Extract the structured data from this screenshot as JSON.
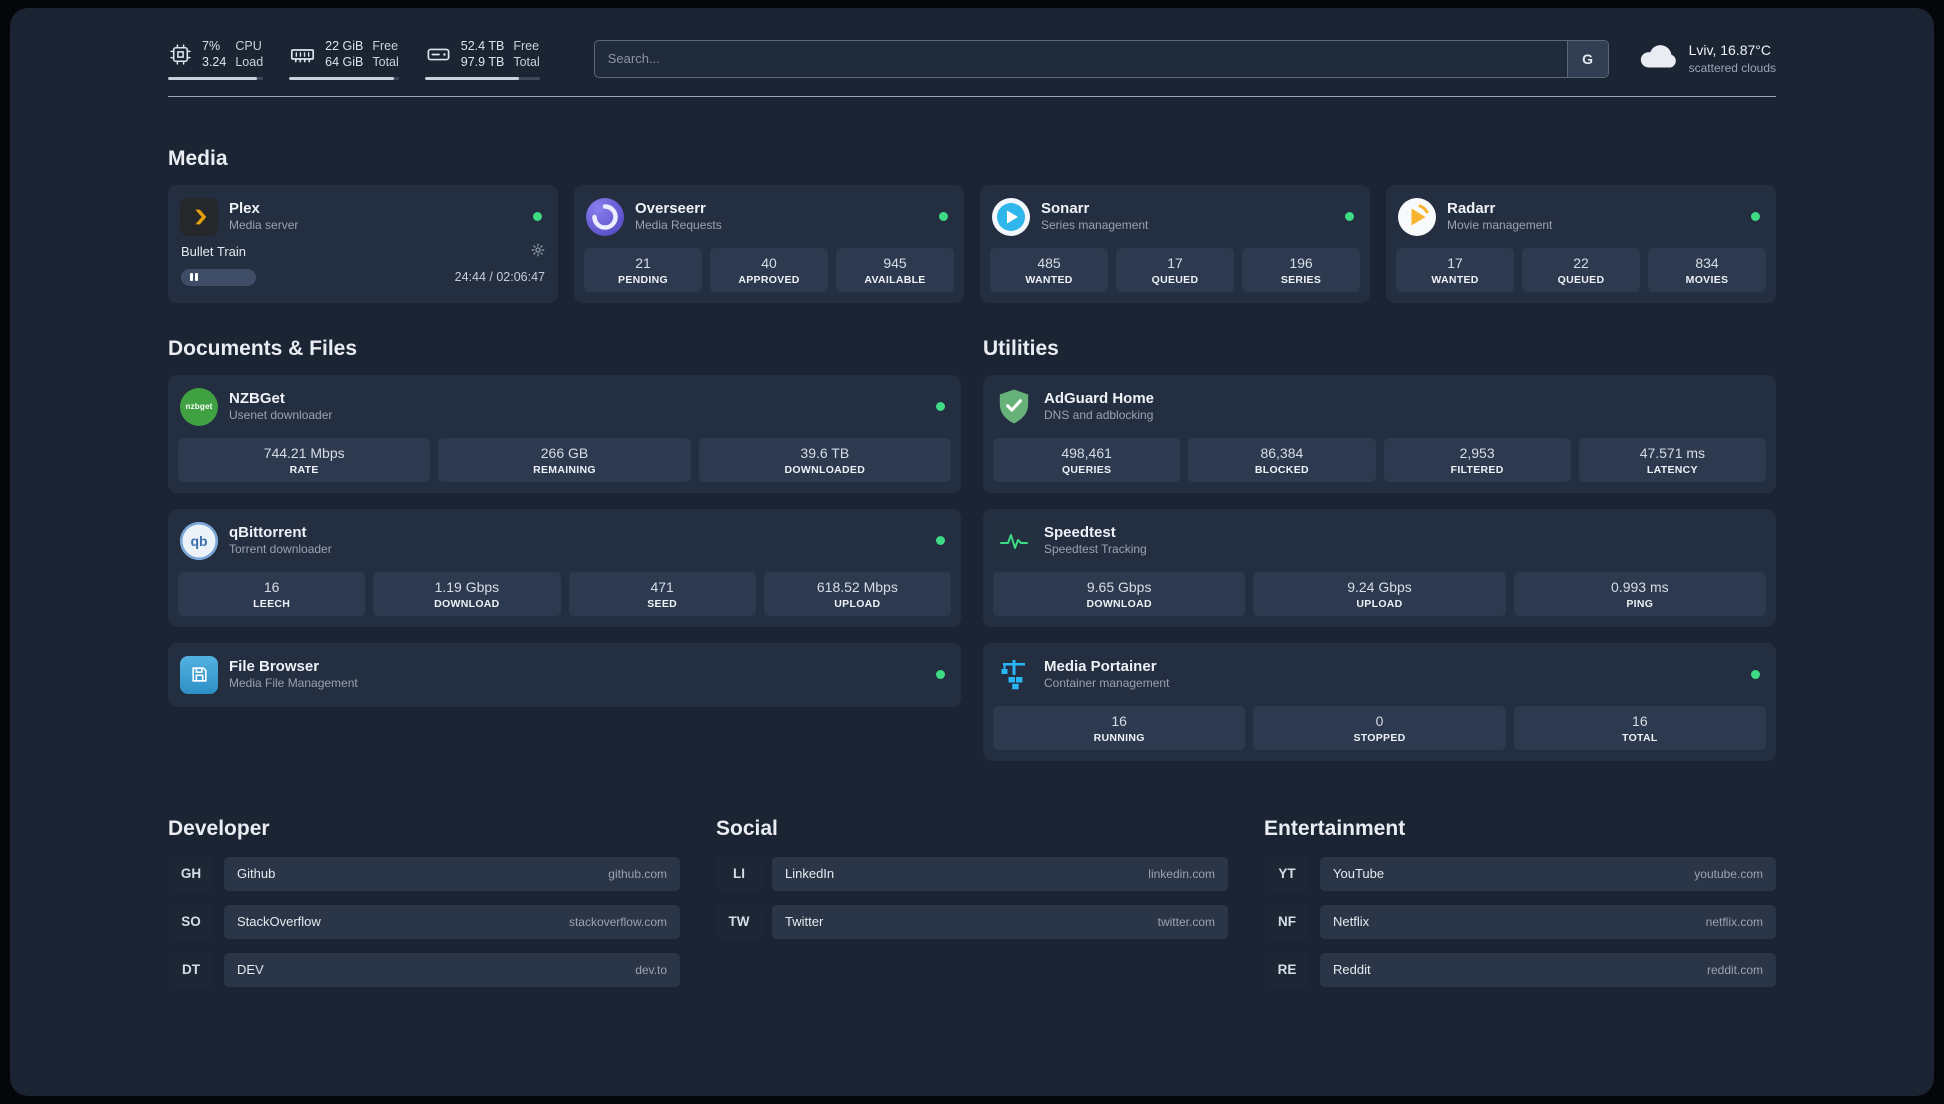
{
  "colors": {
    "page_bg": "#1b2433",
    "card_bg": "#232e40",
    "tile_bg": "#2c394e",
    "status_online": "#3ddc84",
    "plex_amber": "#e5a00d",
    "overseerr_purple": "#5f58d6",
    "sonarr_blue": "#2fb6ea",
    "radarr_amber": "#f7b32b",
    "adguard_green": "#67b279",
    "portainer_blue": "#29b6f6"
  },
  "topbar": {
    "cpu": {
      "value1": "7%",
      "value2": "3.24",
      "label1": "CPU",
      "label2": "Load"
    },
    "memory": {
      "value1": "22 GiB",
      "value2": "64 GiB",
      "label1": "Free",
      "label2": "Total"
    },
    "disk": {
      "value1": "52.4 TB",
      "value2": "97.9 TB",
      "label1": "Free",
      "label2": "Total"
    },
    "search": {
      "placeholder": "Search...",
      "provider_label": "G"
    },
    "weather": {
      "location": "Lviv, 16.87°C",
      "condition": "scattered clouds"
    }
  },
  "sections": {
    "media": {
      "title": "Media",
      "cards": [
        {
          "name": "Plex",
          "subtitle": "Media server",
          "player": {
            "track": "Bullet Train",
            "time": "24:44 / 02:06:47"
          }
        },
        {
          "name": "Overseerr",
          "subtitle": "Media Requests",
          "stats": [
            {
              "value": "21",
              "label": "PENDING"
            },
            {
              "value": "40",
              "label": "APPROVED"
            },
            {
              "value": "945",
              "label": "AVAILABLE"
            }
          ]
        },
        {
          "name": "Sonarr",
          "subtitle": "Series management",
          "stats": [
            {
              "value": "485",
              "label": "WANTED"
            },
            {
              "value": "17",
              "label": "QUEUED"
            },
            {
              "value": "196",
              "label": "SERIES"
            }
          ]
        },
        {
          "name": "Radarr",
          "subtitle": "Movie management",
          "stats": [
            {
              "value": "17",
              "label": "WANTED"
            },
            {
              "value": "22",
              "label": "QUEUED"
            },
            {
              "value": "834",
              "label": "MOVIES"
            }
          ]
        }
      ]
    },
    "documents": {
      "title": "Documents & Files",
      "cards": [
        {
          "name": "NZBGet",
          "subtitle": "Usenet downloader",
          "stats": [
            {
              "value": "744.21 Mbps",
              "label": "RATE"
            },
            {
              "value": "266 GB",
              "label": "REMAINING"
            },
            {
              "value": "39.6 TB",
              "label": "DOWNLOADED"
            }
          ]
        },
        {
          "name": "qBittorrent",
          "subtitle": "Torrent downloader",
          "stats": [
            {
              "value": "16",
              "label": "LEECH"
            },
            {
              "value": "1.19 Gbps",
              "label": "DOWNLOAD"
            },
            {
              "value": "471",
              "label": "SEED"
            },
            {
              "value": "618.52 Mbps",
              "label": "UPLOAD"
            }
          ]
        },
        {
          "name": "File Browser",
          "subtitle": "Media File Management"
        }
      ]
    },
    "utilities": {
      "title": "Utilities",
      "cards": [
        {
          "name": "AdGuard Home",
          "subtitle": "DNS and adblocking",
          "stats": [
            {
              "value": "498,461",
              "label": "QUERIES"
            },
            {
              "value": "86,384",
              "label": "BLOCKED"
            },
            {
              "value": "2,953",
              "label": "FILTERED"
            },
            {
              "value": "47.571 ms",
              "label": "LATENCY"
            }
          ]
        },
        {
          "name": "Speedtest",
          "subtitle": "Speedtest Tracking",
          "stats": [
            {
              "value": "9.65 Gbps",
              "label": "DOWNLOAD"
            },
            {
              "value": "9.24 Gbps",
              "label": "UPLOAD"
            },
            {
              "value": "0.993 ms",
              "label": "PING"
            }
          ]
        },
        {
          "name": "Media Portainer",
          "subtitle": "Container management",
          "stats": [
            {
              "value": "16",
              "label": "RUNNING"
            },
            {
              "value": "0",
              "label": "STOPPED"
            },
            {
              "value": "16",
              "label": "TOTAL"
            }
          ]
        }
      ]
    }
  },
  "bookmarks": [
    {
      "title": "Developer",
      "items": [
        {
          "abbr": "GH",
          "name": "Github",
          "url": "github.com"
        },
        {
          "abbr": "SO",
          "name": "StackOverflow",
          "url": "stackoverflow.com"
        },
        {
          "abbr": "DT",
          "name": "DEV",
          "url": "dev.to"
        }
      ]
    },
    {
      "title": "Social",
      "items": [
        {
          "abbr": "LI",
          "name": "LinkedIn",
          "url": "linkedin.com"
        },
        {
          "abbr": "TW",
          "name": "Twitter",
          "url": "twitter.com"
        }
      ]
    },
    {
      "title": "Entertainment",
      "items": [
        {
          "abbr": "YT",
          "name": "YouTube",
          "url": "youtube.com"
        },
        {
          "abbr": "NF",
          "name": "Netflix",
          "url": "netflix.com"
        },
        {
          "abbr": "RE",
          "name": "Reddit",
          "url": "reddit.com"
        }
      ]
    }
  ]
}
